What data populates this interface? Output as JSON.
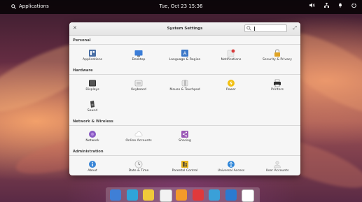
{
  "panel": {
    "applications_label": "Applications",
    "clock": "Tue, Oct 23   15:36"
  },
  "window": {
    "title": "System Settings",
    "search_value": ""
  },
  "sections": [
    {
      "title": "Personal",
      "items": [
        {
          "label": "Applications",
          "icon": "applications-icon",
          "color": "#4a6fa5"
        },
        {
          "label": "Desktop",
          "icon": "desktop-icon",
          "color": "#3b7dd8"
        },
        {
          "label": "Language & Region",
          "icon": "language-region-icon",
          "color": "#3c78c8"
        },
        {
          "label": "Notifications",
          "icon": "notifications-icon",
          "color": "#d83a3a"
        },
        {
          "label": "Security & Privacy",
          "icon": "lock-icon",
          "color": "#e0a425"
        }
      ]
    },
    {
      "title": "Hardware",
      "items": [
        {
          "label": "Displays",
          "icon": "display-icon",
          "color": "#2f2f2f"
        },
        {
          "label": "Keyboard",
          "icon": "keyboard-icon",
          "color": "#9a9a9a"
        },
        {
          "label": "Mouse & Touchpad",
          "icon": "mouse-icon",
          "color": "#bdbdbd"
        },
        {
          "label": "Power",
          "icon": "power-icon",
          "color": "#f2c012"
        },
        {
          "label": "Printers",
          "icon": "printer-icon",
          "color": "#2e2e2e"
        },
        {
          "label": "Sound",
          "icon": "sound-icon",
          "color": "#444444"
        }
      ]
    },
    {
      "title": "Network & Wireless",
      "items": [
        {
          "label": "Network",
          "icon": "network-icon",
          "color": "#8a5bc4"
        },
        {
          "label": "Online Accounts",
          "icon": "cloud-icon",
          "color": "#cfcfcf"
        },
        {
          "label": "Sharing",
          "icon": "sharing-icon",
          "color": "#9b59b6"
        }
      ]
    },
    {
      "title": "Administration",
      "items": [
        {
          "label": "About",
          "icon": "about-icon",
          "color": "#3a86d6"
        },
        {
          "label": "Date & Time",
          "icon": "clock-icon",
          "color": "#bdbdbd"
        },
        {
          "label": "Parental Control",
          "icon": "parental-control-icon",
          "color": "#e6b422"
        },
        {
          "label": "Universal Access",
          "icon": "universal-access-icon",
          "color": "#2f86d8"
        },
        {
          "label": "User Accounts",
          "icon": "user-accounts-icon",
          "color": "#bdbdbd"
        }
      ]
    }
  ],
  "dock": [
    {
      "icon": "multitasking-view-icon",
      "color": "#3f7fd6"
    },
    {
      "icon": "web-browser-icon",
      "color": "#2fa4d9"
    },
    {
      "icon": "mail-icon",
      "color": "#f0c93a"
    },
    {
      "icon": "calendar-icon",
      "color": "#f2f2f2"
    },
    {
      "icon": "music-icon",
      "color": "#f39a2a"
    },
    {
      "icon": "videos-icon",
      "color": "#e0393b"
    },
    {
      "icon": "photos-icon",
      "color": "#3aa0d8"
    },
    {
      "icon": "terminal-icon",
      "color": "#2a7ad0"
    },
    {
      "icon": "app-center-icon",
      "color": "#ffffff"
    }
  ]
}
